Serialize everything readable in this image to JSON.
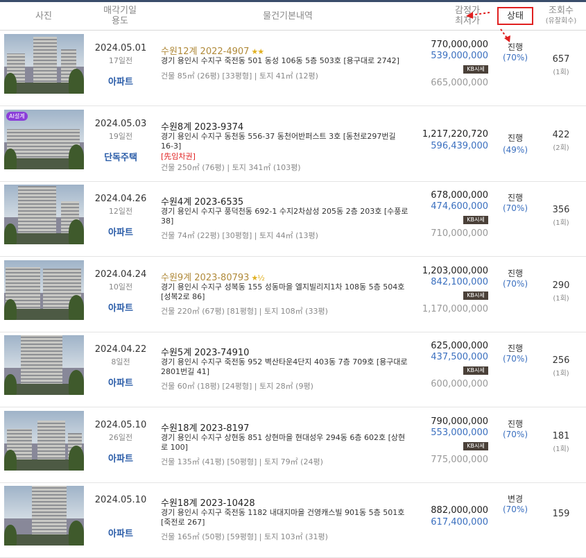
{
  "header": {
    "photo": "사진",
    "date_line1": "매각기일",
    "date_line2": "용도",
    "info": "물건기본내역",
    "price_line1": "감정가",
    "price_line2": "최저가",
    "status": "상태",
    "views_line1": "조회수",
    "views_line2": "(유찰회수)"
  },
  "kb_badge": "KB시세",
  "ai_badge": "AI설계",
  "colors": {
    "accent_red": "#e02020",
    "price_blue": "#3a6fbf",
    "usage_blue": "#2a5ca8",
    "case_gold": "#b08a3a"
  },
  "rows": [
    {
      "date": "2024.05.01",
      "ago": "17일전",
      "usage": "아파트",
      "case": "수원12계 2022-4907",
      "stars": "★★",
      "address": "경기 용인시 수지구 죽전동 501 동성 106동 5층 503호 [용구대로 2742]",
      "area": "건물 85㎡ (26평) [33평형]  |  토지 41㎡ (12평)",
      "appraisal": "770,000,000",
      "minimum": "539,000,000",
      "market": "665,000,000",
      "status": "진행",
      "percent": "(70%)",
      "views": "657",
      "failed": "(1회)"
    },
    {
      "date": "2024.05.03",
      "ago": "19일전",
      "usage": "단독주택",
      "case": "수원8계 2023-9374",
      "address": "경기 용인시 수지구 동천동 556-37 동천어반퍼스트 3호 [동천로297번길 16-3]",
      "flag": "[先임차권]",
      "area": "건물 250㎡ (76평)  |  토지 341㎡ (103평)",
      "appraisal": "1,217,220,720",
      "minimum": "596,439,000",
      "status": "진행",
      "percent": "(49%)",
      "views": "422",
      "failed": "(2회)"
    },
    {
      "date": "2024.04.26",
      "ago": "12일전",
      "usage": "아파트",
      "case": "수원4계 2023-6535",
      "address": "경기 용인시 수지구 풍덕천동 692-1 수지2차삼성 205동 2층 203호 [수풍로 38]",
      "area": "건물 74㎡ (22평) [30평형]  |  토지 44㎡ (13평)",
      "appraisal": "678,000,000",
      "minimum": "474,600,000",
      "market": "710,000,000",
      "status": "진행",
      "percent": "(70%)",
      "views": "356",
      "failed": "(1회)"
    },
    {
      "date": "2024.04.24",
      "ago": "10일전",
      "usage": "아파트",
      "case": "수원9계 2023-80793",
      "stars": "★½",
      "address": "경기 용인시 수지구 성복동 155 성동마을 엘지빌리지1차 108동 5층 504호 [성복2로 86]",
      "area": "건물 220㎡ (67평) [81평형]  |  토지 108㎡ (33평)",
      "appraisal": "1,203,000,000",
      "minimum": "842,100,000",
      "market": "1,170,000,000",
      "status": "진행",
      "percent": "(70%)",
      "views": "290",
      "failed": "(1회)"
    },
    {
      "date": "2024.04.22",
      "ago": "8일전",
      "usage": "아파트",
      "case": "수원5계 2023-74910",
      "address": "경기 용인시 수지구 죽전동 952 벽산타운4단지 403동 7층 709호 [용구대로2801번길 41]",
      "area": "건물 60㎡ (18평) [24평형]  |  토지 28㎡ (9평)",
      "appraisal": "625,000,000",
      "minimum": "437,500,000",
      "market": "600,000,000",
      "status": "진행",
      "percent": "(70%)",
      "views": "256",
      "failed": "(1회)"
    },
    {
      "date": "2024.05.10",
      "ago": "26일전",
      "usage": "아파트",
      "case": "수원18계 2023-8197",
      "address": "경기 용인시 수지구 상현동 851 상현마을 현대성우 294동 6층 602호 [상현로 100]",
      "area": "건물 135㎡ (41평) [50평형]  |  토지 79㎡ (24평)",
      "appraisal": "790,000,000",
      "minimum": "553,000,000",
      "market": "775,000,000",
      "status": "진행",
      "percent": "(70%)",
      "views": "181",
      "failed": "(1회)"
    },
    {
      "date": "2024.05.10",
      "ago": "",
      "usage": "아파트",
      "case": "수원18계 2023-10428",
      "address": "경기 용인시 수지구 죽전동 1182 내대지마을 건영캐스빌 901동 5층 501호 [죽전로 267]",
      "area": "건물 165㎡ (50평) [59평형]  |  토지 103㎡ (31평)",
      "appraisal": "882,000,000",
      "minimum": "617,400,000",
      "status": "변경",
      "percent": "(70%)",
      "views": "159",
      "failed": ""
    }
  ]
}
